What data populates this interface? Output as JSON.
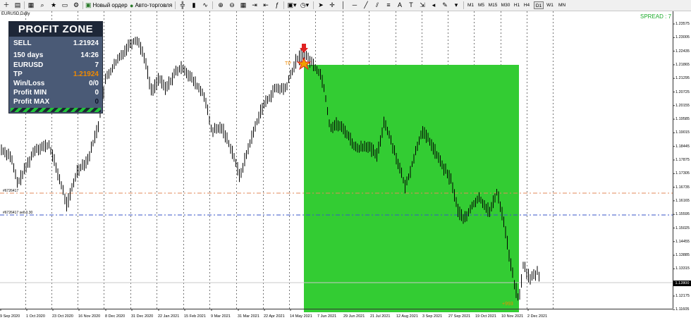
{
  "toolbar": {
    "new_order_label": "Новый ордер",
    "auto_trading_label": "Авто-торговля",
    "timeframes": [
      "M1",
      "M5",
      "M15",
      "M30",
      "H1",
      "H4",
      "D1",
      "W1",
      "MN"
    ],
    "active_timeframe": "D1"
  },
  "chart": {
    "symbol_label": "EURUSD,Daily",
    "spread_label": "SPREAD : 7",
    "tp_label": "TP",
    "profit_label": "+993",
    "hline1_label": "#6726417",
    "hline2_label": "#6726417 sell 0.30",
    "colors": {
      "profit_zone": "#33cc33",
      "hline_orange": "#e08a5a",
      "hline_blue": "#3a55c8",
      "accent_orange": "#f08a00",
      "spread_green": "#1bab2a"
    },
    "price_labels": [
      "1.23575",
      "1.23005",
      "1.22435",
      "1.21865",
      "1.21295",
      "1.20725",
      "1.20155",
      "1.19585",
      "1.19015",
      "1.18445",
      "1.17875",
      "1.17305",
      "1.16735",
      "1.16165",
      "1.15595",
      "1.15025",
      "1.14455",
      "1.13885",
      "1.13315",
      "1.12745",
      "1.12175",
      "1.11605"
    ],
    "current_price": "1.12800",
    "time_labels": [
      "9 Sep 2020",
      "1 Oct 2020",
      "23 Oct 2020",
      "16 Nov 2020",
      "8 Dec 2020",
      "31 Dec 2020",
      "22 Jan 2021",
      "15 Feb 2021",
      "9 Mar 2021",
      "31 Mar 2021",
      "22 Apr 2021",
      "14 May 2021",
      "7 Jun 2021",
      "29 Jun 2021",
      "21 Jul 2021",
      "12 Aug 2021",
      "3 Sep 2021",
      "27 Sep 2021",
      "19 Oct 2021",
      "10 Nov 2021",
      "2 Dec 2021"
    ]
  },
  "panel": {
    "title": "PROFIT ZONE",
    "rows": [
      {
        "key": "SELL",
        "value": "1.21924"
      },
      {
        "key": "150 days",
        "value": "14:26"
      },
      {
        "key": "EURUSD",
        "value": "7"
      },
      {
        "key": "TP",
        "value": "1.21924"
      },
      {
        "key": "Win/Loss",
        "value": "0/0"
      },
      {
        "key": "Profit MIN",
        "value": "0"
      },
      {
        "key": "Profit MAX",
        "value": "0"
      }
    ]
  }
}
